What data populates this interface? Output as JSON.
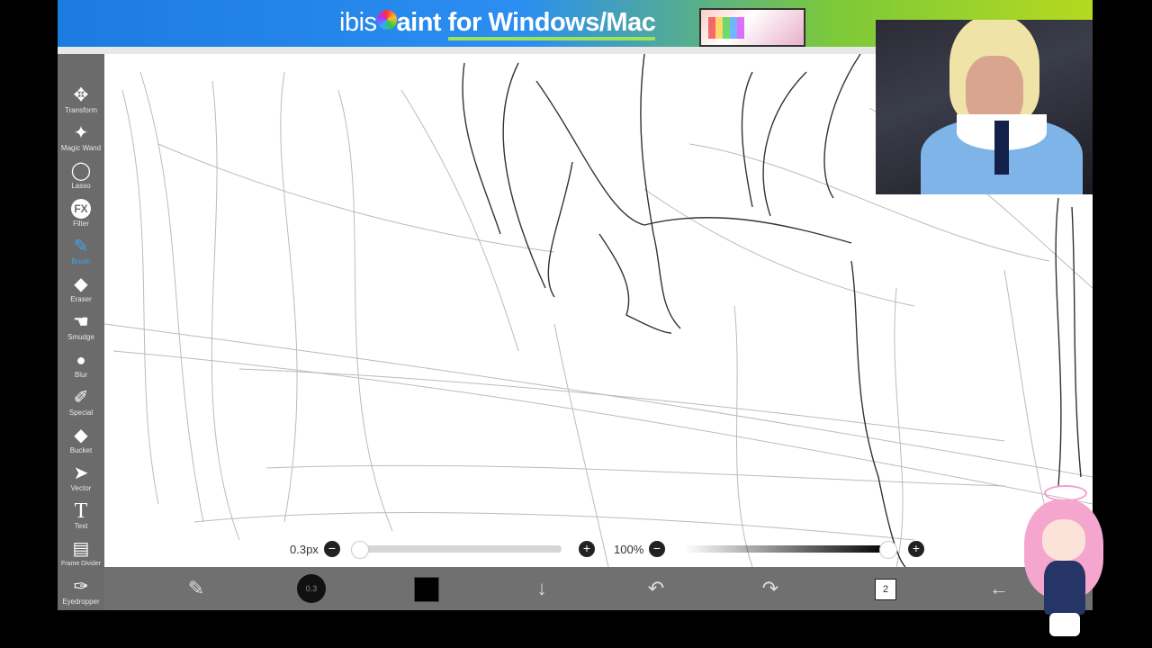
{
  "banner": {
    "ibis": "ibis",
    "rest": "aint ",
    "highlight": "for Windows/Mac"
  },
  "tools": [
    {
      "label": "Transform",
      "icon": "move-icon",
      "glyph": "✥"
    },
    {
      "label": "Magic Wand",
      "icon": "magic-wand-icon",
      "glyph": "✦"
    },
    {
      "label": "Lasso",
      "icon": "lasso-icon",
      "glyph": "◯"
    },
    {
      "label": "Filter",
      "icon": "fx-icon",
      "glyph": "FX"
    },
    {
      "label": "Brush",
      "icon": "brush-icon",
      "glyph": "✎",
      "active": true
    },
    {
      "label": "Eraser",
      "icon": "eraser-icon",
      "glyph": "◆"
    },
    {
      "label": "Smudge",
      "icon": "smudge-icon",
      "glyph": "☚"
    },
    {
      "label": "Blur",
      "icon": "blur-drop-icon",
      "glyph": "💧"
    },
    {
      "label": "Special",
      "icon": "special-pen-icon",
      "glyph": "✐"
    },
    {
      "label": "Bucket",
      "icon": "bucket-icon",
      "glyph": "◆"
    },
    {
      "label": "Vector",
      "icon": "vector-cursor-icon",
      "glyph": "➤"
    },
    {
      "label": "Text",
      "icon": "text-icon",
      "glyph": "T"
    },
    {
      "label": "Frame Divider",
      "icon": "frame-divider-icon",
      "glyph": "▤"
    },
    {
      "label": "Eyedropper",
      "icon": "eyedropper-icon",
      "glyph": "✑"
    }
  ],
  "brush_slider": {
    "value_text": "0.3px",
    "fraction": 0.0
  },
  "opacity_slider": {
    "value_text": "100%",
    "fraction": 1.0
  },
  "bottom": {
    "brush_size_text": "0.3",
    "layers_count": "2",
    "color": "#000000"
  }
}
